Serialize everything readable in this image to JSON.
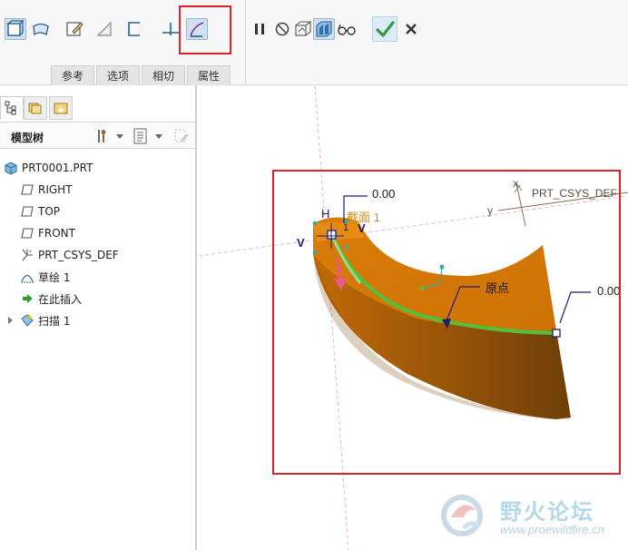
{
  "ribbon": {
    "tools": [
      {
        "name": "solid-icon",
        "pressed": true
      },
      {
        "name": "surface-icon",
        "pressed": false
      },
      {
        "name": "sketch-edit-icon",
        "pressed": false
      },
      {
        "name": "remove-material-icon",
        "pressed": false
      },
      {
        "name": "thicken-icon",
        "pressed": false
      },
      {
        "name": "constant-section-icon",
        "pressed": false
      },
      {
        "name": "variable-section-icon",
        "pressed": true
      }
    ],
    "actions": [
      "pause-icon",
      "no-preview-icon",
      "preview-icon",
      "verify-icon",
      "glasses-icon",
      "ok-checkmark-icon",
      "cancel-x-icon"
    ],
    "tabs": [
      "参考",
      "选项",
      "相切",
      "属性"
    ]
  },
  "panel": {
    "tree_title": "模型树",
    "items": [
      {
        "label": "PRT0001.PRT",
        "icon": "part-icon"
      },
      {
        "label": "RIGHT",
        "icon": "datum-plane-icon"
      },
      {
        "label": "TOP",
        "icon": "datum-plane-icon"
      },
      {
        "label": "FRONT",
        "icon": "datum-plane-icon"
      },
      {
        "label": "PRT_CSYS_DEF",
        "icon": "csys-icon"
      },
      {
        "label": "草绘 1",
        "icon": "sketch-icon"
      },
      {
        "label": "在此插入",
        "icon": "insert-arrow-icon"
      },
      {
        "label": "扫描 1",
        "icon": "sweep-icon"
      }
    ]
  },
  "viewport": {
    "dim_top": "0.00",
    "dim_right": "0.00",
    "section_label": "截面 1",
    "origin_label": "原点",
    "csys_label": "PRT_CSYS_DEF",
    "axis_x": "x",
    "axis_y": "y",
    "v_label": "V",
    "h_label": "H",
    "one_label": "1"
  },
  "watermark": {
    "title": "野火论坛",
    "url": "www.proewildfire.cn"
  },
  "colors": {
    "accent_red": "#d9242b",
    "sweep_top": "#d97c09",
    "sweep_side": "#9a5508",
    "trajectory_green": "#4ec23c"
  }
}
